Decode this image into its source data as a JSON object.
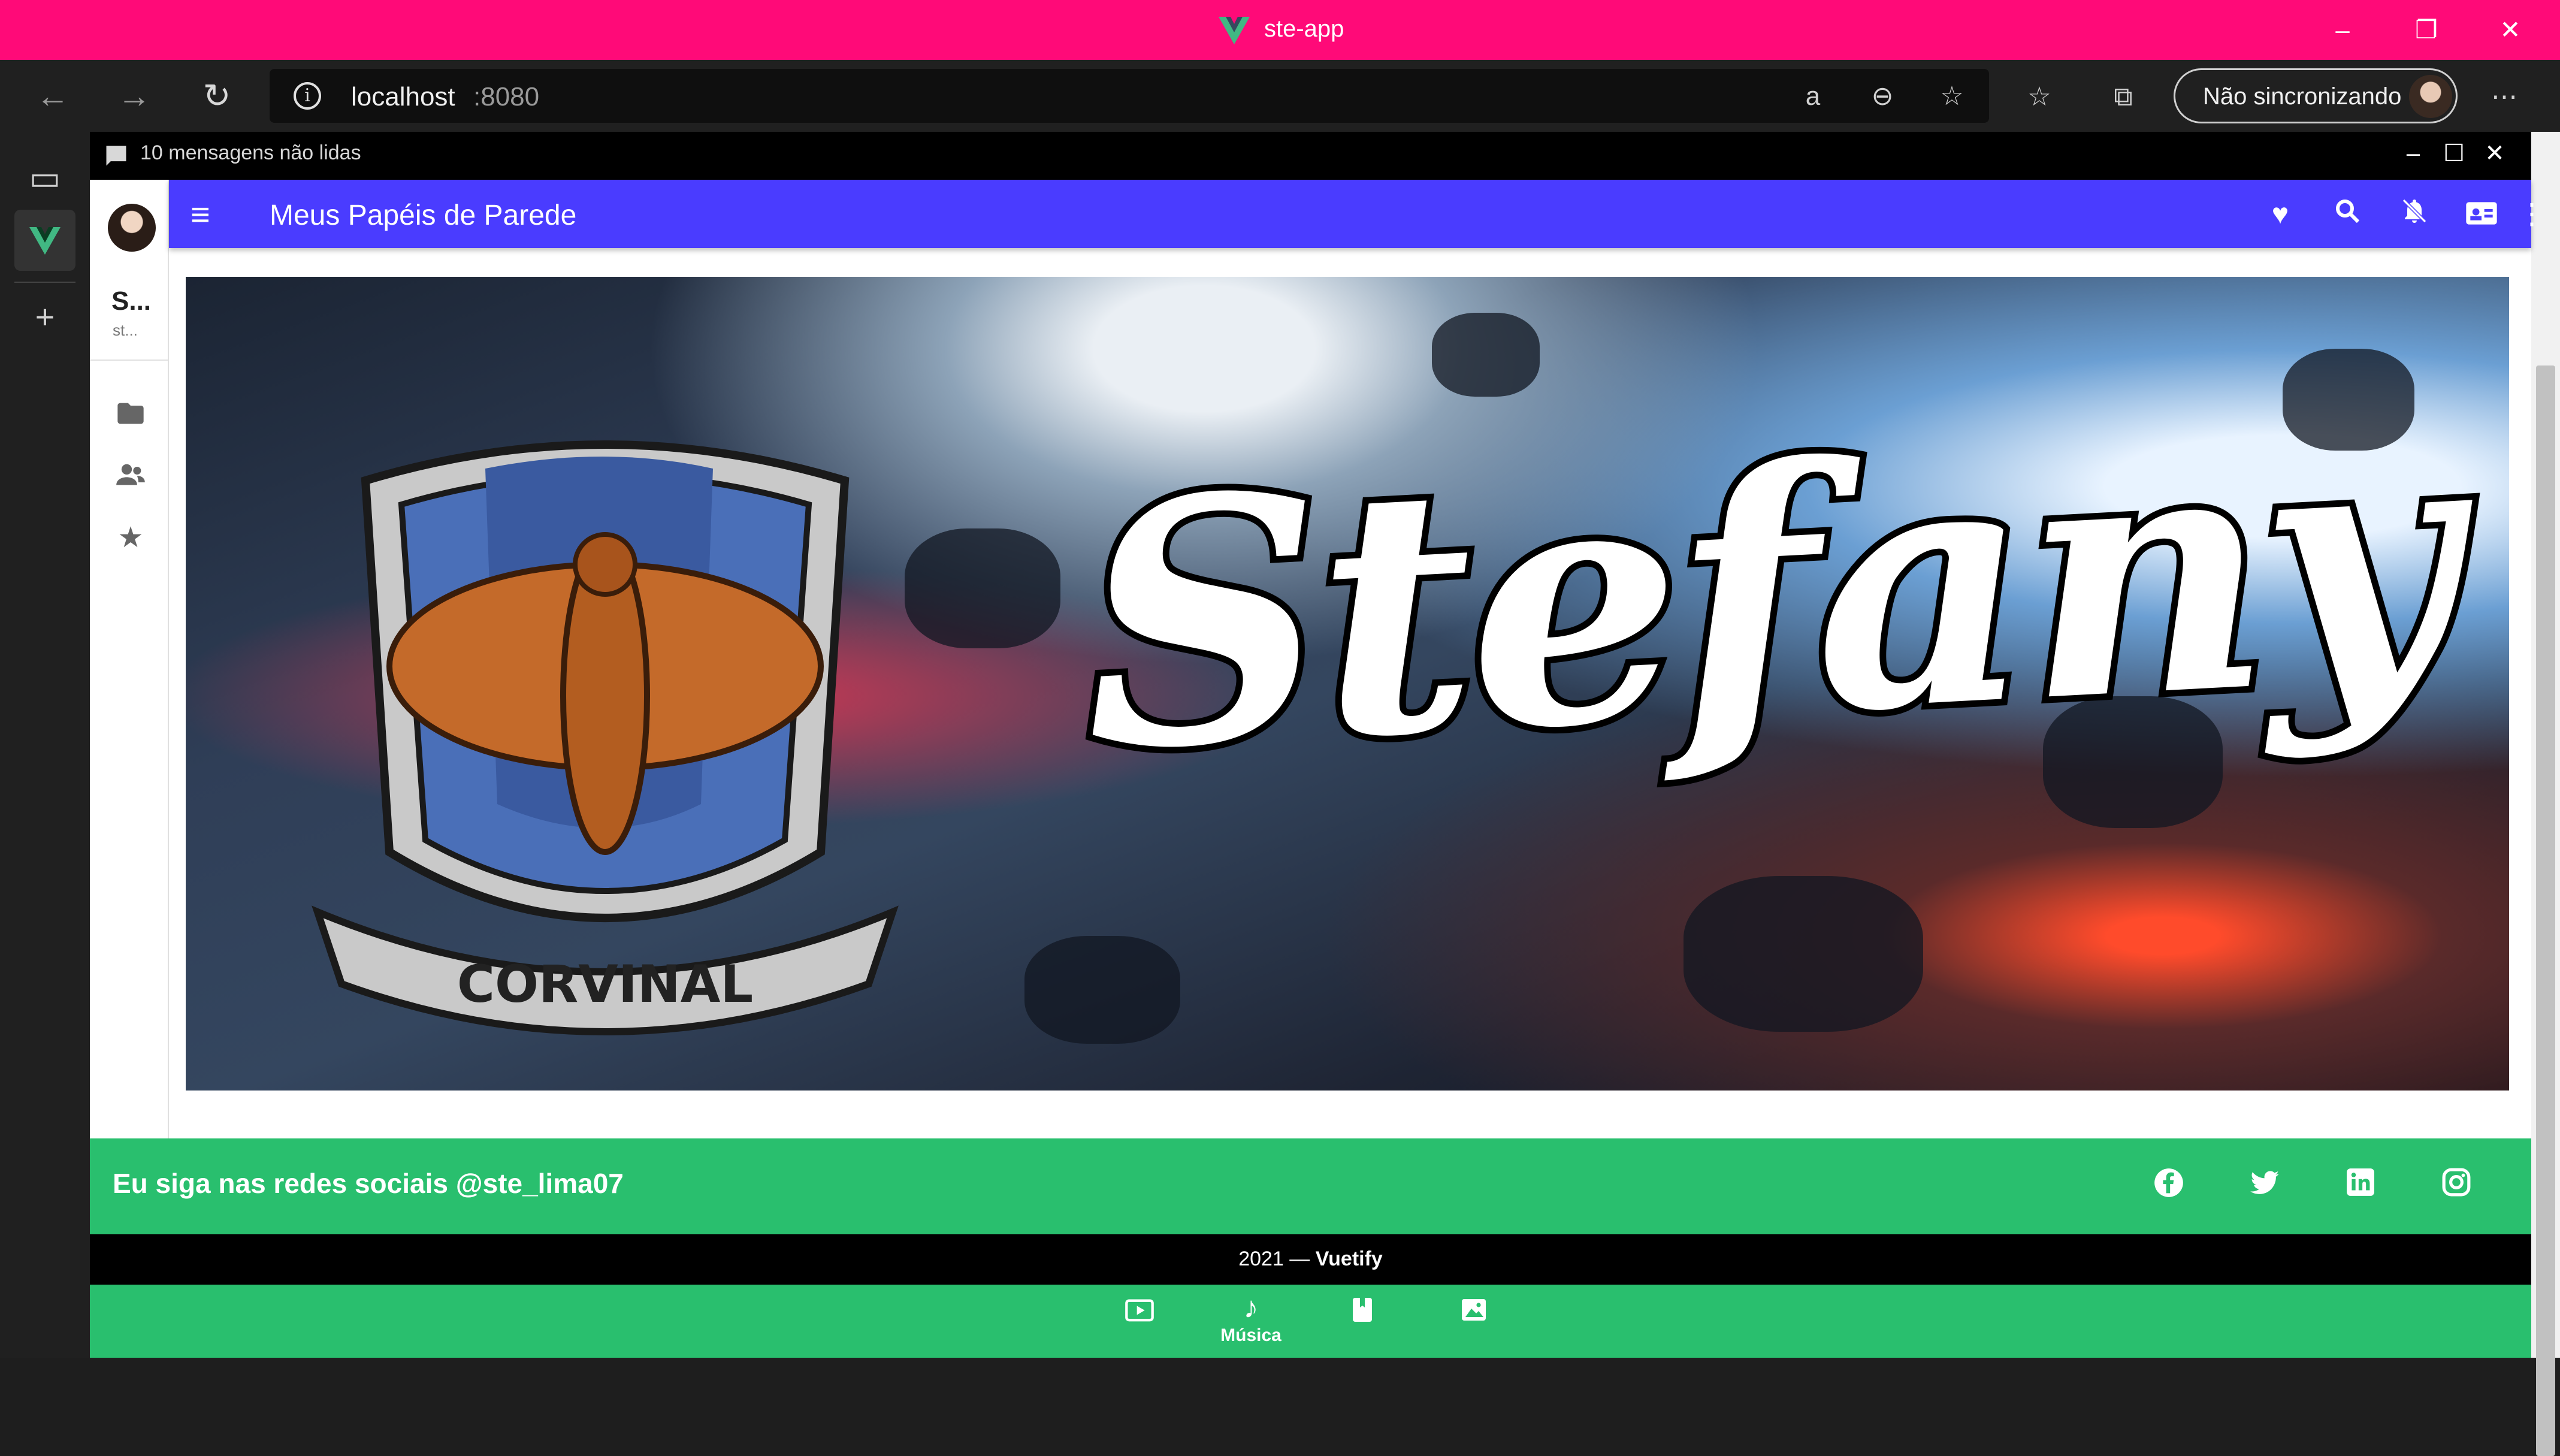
{
  "window": {
    "title": "ste-app"
  },
  "browser": {
    "url_host": "localhost",
    "url_port": ":8080",
    "sync_label": "Não sincronizando"
  },
  "panel": {
    "unread_label": "10 mensagens não lidas"
  },
  "drawer": {
    "user_name": "S...",
    "user_handle": "st..."
  },
  "appbar": {
    "title": "Meus Papéis de Parede"
  },
  "banner": {
    "name_text": "Stefany",
    "crest_text": "CORVINAL"
  },
  "footer": {
    "social_text": "Eu siga nas redes sociais @ste_lima07",
    "copyright_year": "2021 — ",
    "copyright_brand": "Vuetify"
  },
  "bottom_nav": {
    "items": [
      {
        "icon": "video-icon",
        "label": ""
      },
      {
        "icon": "music-icon",
        "label": "Música"
      },
      {
        "icon": "book-icon",
        "label": ""
      },
      {
        "icon": "image-icon",
        "label": ""
      }
    ]
  },
  "colors": {
    "titlebar": "#ff0a78",
    "appbar": "#4a3cff",
    "footer": "#29bf6e"
  }
}
